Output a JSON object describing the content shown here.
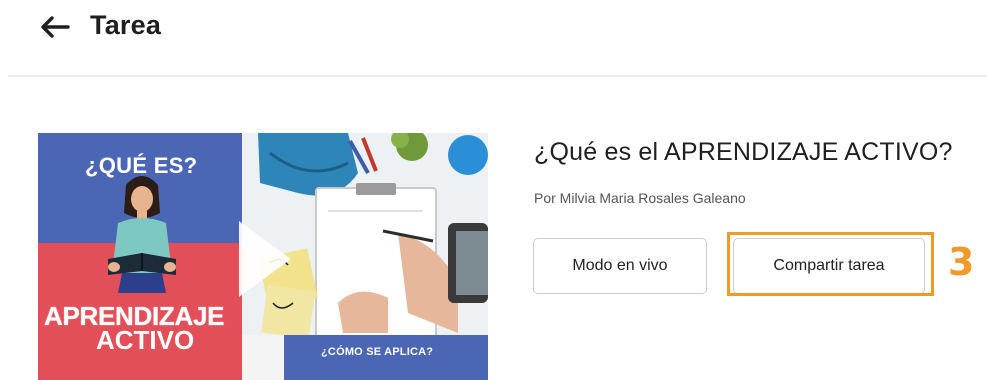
{
  "header": {
    "title": "Tarea",
    "back_icon": "arrow-left-icon"
  },
  "lesson": {
    "title": "¿Qué es el APRENDIZAJE ACTIVO?",
    "author": "Por Milvia Maria Rosales Galeano",
    "thumbnail": {
      "heading": "¿QUÉ ES?",
      "big_text_line1": "APRENDIZAJE",
      "big_text_line2": "ACTIVO",
      "subtitle": "¿CÓMO SE APLICA?",
      "play_icon": "play-icon",
      "colors": {
        "blue": "#4a66b4",
        "red": "#e34f58"
      }
    }
  },
  "actions": {
    "live_mode_label": "Modo en vivo",
    "share_label": "Compartir tarea"
  },
  "annotation": {
    "step_number": "3",
    "color": "#f09a2b"
  }
}
